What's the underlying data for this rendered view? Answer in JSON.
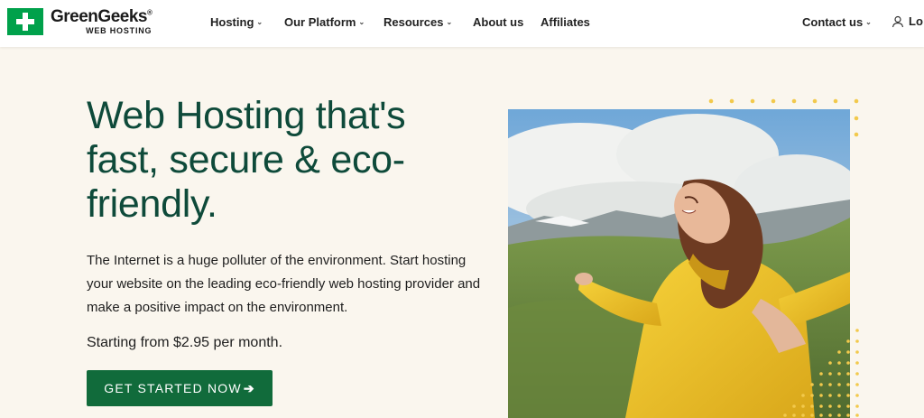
{
  "brand": {
    "name": "GreenGeeks",
    "registered": "®",
    "tagline": "WEB HOSTING",
    "accent_color": "#00a14b"
  },
  "nav": {
    "items": [
      {
        "label": "Hosting",
        "has_dropdown": true
      },
      {
        "label": "Our Platform",
        "has_dropdown": true
      },
      {
        "label": "Resources",
        "has_dropdown": true
      },
      {
        "label": "About us",
        "has_dropdown": false
      },
      {
        "label": "Affiliates",
        "has_dropdown": false
      }
    ],
    "contact": {
      "label": "Contact us",
      "has_dropdown": true
    },
    "login": {
      "label": "Lo",
      "icon": "user-icon"
    }
  },
  "hero": {
    "headline": "Web Hosting that's fast, secure & eco-friendly.",
    "description": "The Internet is a huge polluter of the environment. Start hosting your website on the leading eco-friendly web hosting provider and make a positive impact on the environment.",
    "price_prefix": "Starting from ",
    "price": "$2.95",
    "price_suffix": " per month.",
    "cta_label": "GET STARTED NOW",
    "cta_icon": "arrow-right-icon",
    "headline_color": "#0e4a3a",
    "cta_color": "#116b3b",
    "dots_color": "#f2c94c"
  }
}
